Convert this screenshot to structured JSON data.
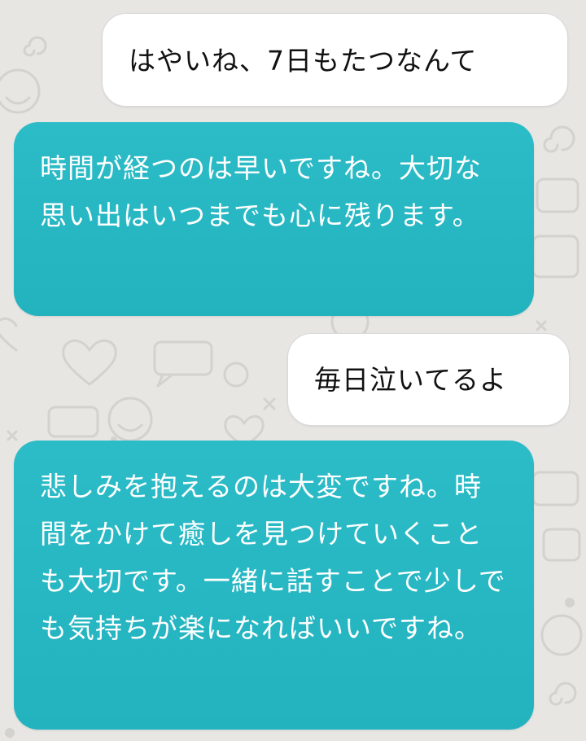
{
  "conversation": {
    "messages": [
      {
        "role": "sent",
        "text": "はやいね、7日もたつなんて"
      },
      {
        "role": "received",
        "text": "時間が経つのは早いですね。大切な思い出はいつまでも心に残ります。"
      },
      {
        "role": "sent",
        "text": "毎日泣いてるよ"
      },
      {
        "role": "received",
        "text": "悲しみを抱えるのは大変ですね。時間をかけて癒しを見つけていくことも大切です。一緒に話すことで少しでも気持ちが楽になればいいですね。"
      }
    ]
  },
  "colors": {
    "background": "#e7e6e3",
    "doodle": "#d3d2cf",
    "sent_bubble": "#ffffff",
    "received_bubble": "#25b6c2",
    "received_text": "#ffffff",
    "sent_text": "#111111"
  },
  "background_pattern_icons": [
    "heart-icon",
    "chat-bubble-icon",
    "smiley-icon",
    "spiral-icon",
    "cross-icon",
    "dot-icon"
  ]
}
